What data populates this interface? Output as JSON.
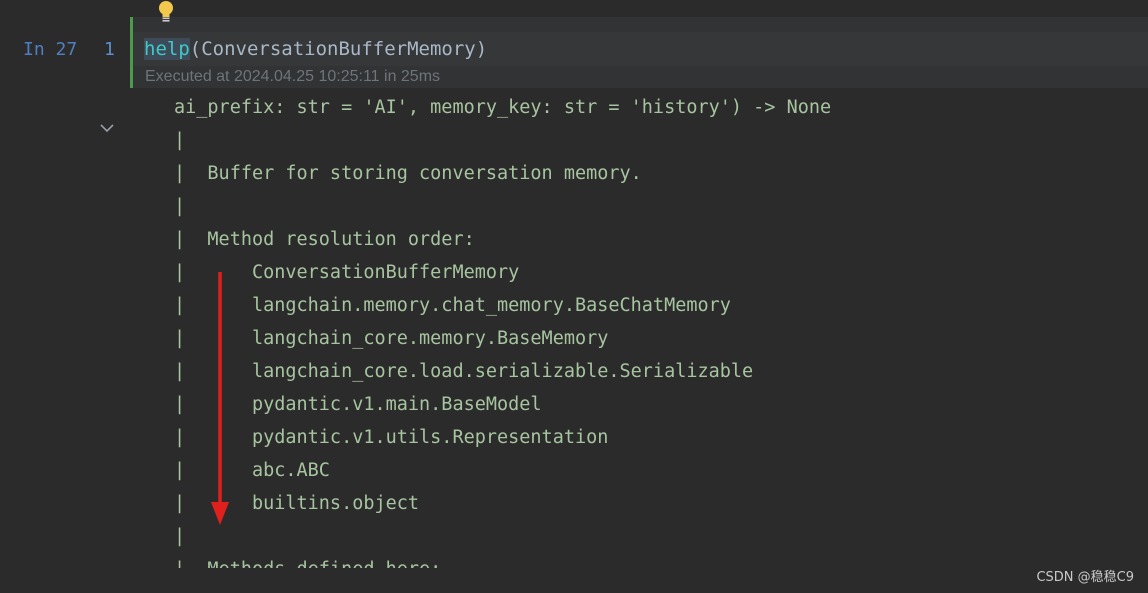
{
  "cell": {
    "prompt_label": "In 27",
    "line_number": "1",
    "code_function": "help",
    "code_args": "(ConversationBufferMemory)",
    "execution_status": "Executed at 2024.04.25 10:25:11 in 25ms"
  },
  "output": {
    "lines": [
      "ai_prefix: str = 'AI', memory_key: str = 'history') -> None",
      "|",
      "|  Buffer for storing conversation memory.",
      "|",
      "|  Method resolution order:",
      "|      ConversationBufferMemory",
      "|      langchain.memory.chat_memory.BaseChatMemory",
      "|      langchain_core.memory.BaseMemory",
      "|      langchain_core.load.serializable.Serializable",
      "|      pydantic.v1.main.BaseModel",
      "|      pydantic.v1.utils.Representation",
      "|      abc.ABC",
      "|      builtins.object",
      "|",
      "|  Methods defined here:"
    ]
  },
  "icons": {
    "bulb": "lightbulb-icon",
    "collapse": "chevron-down-icon",
    "arrow": "red-down-arrow"
  },
  "colors": {
    "background": "#2b2b2b",
    "cell_border": "#4c9a4c",
    "output_text": "#a7c4a0",
    "function_name": "#3fc9c9",
    "annotation_arrow": "#e0201c"
  },
  "watermark": "CSDN @稳稳C9"
}
